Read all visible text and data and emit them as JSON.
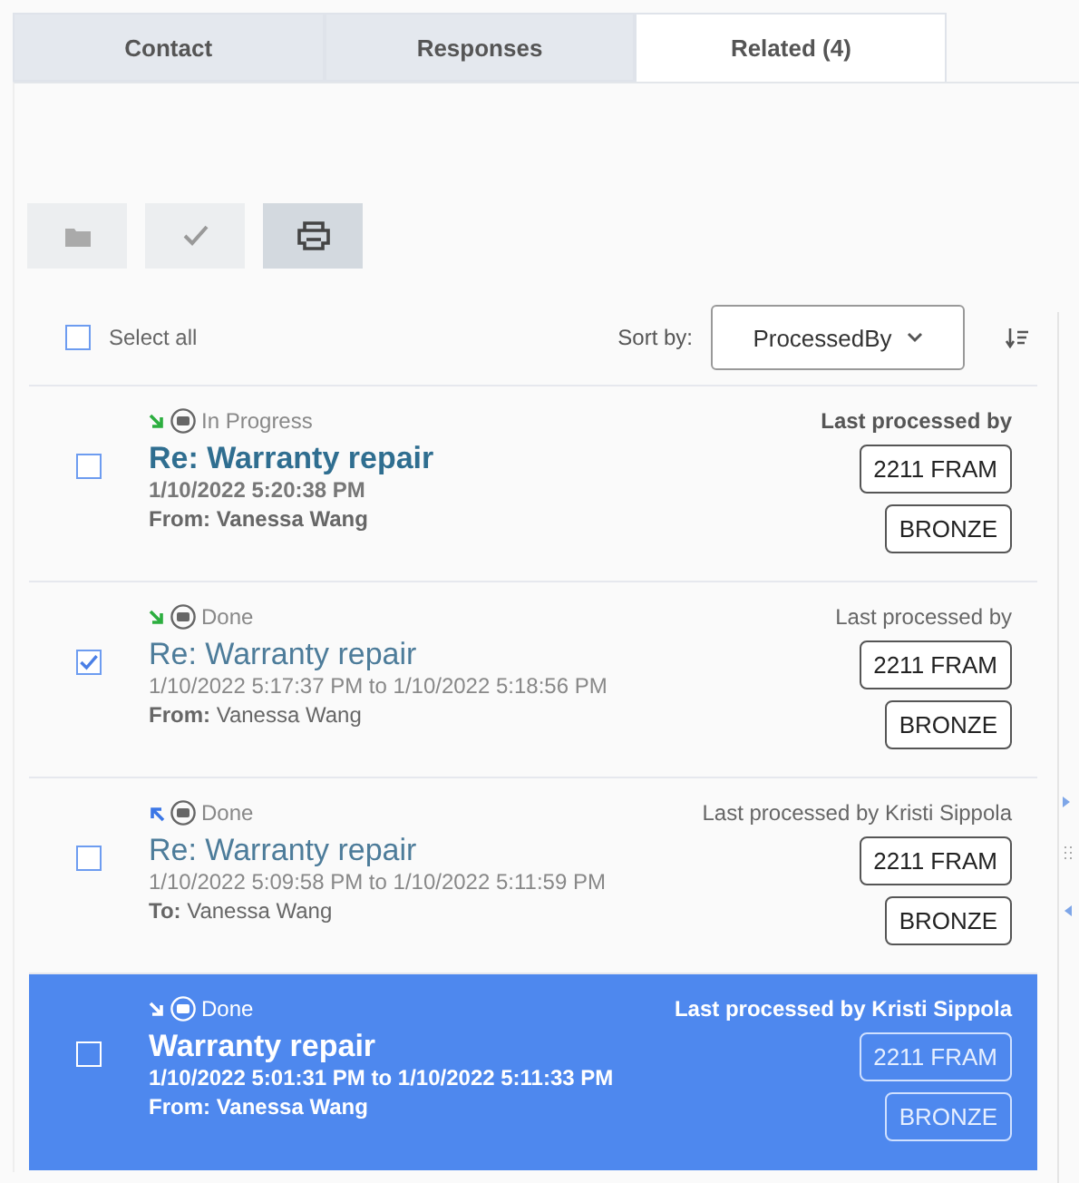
{
  "tabs": [
    {
      "label": "Contact",
      "selected": false
    },
    {
      "label": "Responses",
      "selected": false
    },
    {
      "label": "Related (4)",
      "selected": true
    }
  ],
  "toolbar": [
    {
      "kind": "folder",
      "disabled": true
    },
    {
      "kind": "check",
      "disabled": true
    },
    {
      "kind": "print",
      "disabled": false
    }
  ],
  "select_all": {
    "label": "Select all",
    "checked": false
  },
  "sort": {
    "label": "Sort by:",
    "value": "ProcessedBy"
  },
  "items": [
    {
      "kind": "inbound",
      "status": "In Progress",
      "title": "Re: Warranty repair",
      "time": "1/10/2022 5:20:38 PM",
      "party": "**From:** Vanessa Wang",
      "processed": "Last processed by",
      "tags": [
        "2211 FRAM",
        "BRONZE"
      ],
      "checked": false,
      "unread": true,
      "selected": false
    },
    {
      "kind": "inbound",
      "status": "Done",
      "title": "Re: Warranty repair",
      "time": "1/10/2022 5:17:37 PM to 1/10/2022 5:18:56 PM",
      "party": "**From:** Vanessa Wang",
      "processed": "Last processed by",
      "tags": [
        "2211 FRAM",
        "BRONZE"
      ],
      "checked": true,
      "unread": false,
      "selected": false
    },
    {
      "kind": "outbound",
      "status": "Done",
      "title": "Re: Warranty repair",
      "time": "1/10/2022 5:09:58 PM to 1/10/2022 5:11:59 PM",
      "party": "**To:** Vanessa Wang",
      "processed": "Last processed by Kristi Sippola",
      "tags": [
        "2211 FRAM",
        "BRONZE"
      ],
      "checked": false,
      "unread": false,
      "selected": false
    },
    {
      "kind": "inbound",
      "status": "Done",
      "title": "Warranty repair",
      "time": "1/10/2022 5:01:31 PM to 1/10/2022 5:11:33 PM",
      "party": "**From:** Vanessa Wang",
      "processed": "Last processed by Kristi Sippola",
      "tags": [
        "2211 FRAM",
        "BRONZE"
      ],
      "checked": false,
      "unread": true,
      "selected": true
    }
  ]
}
